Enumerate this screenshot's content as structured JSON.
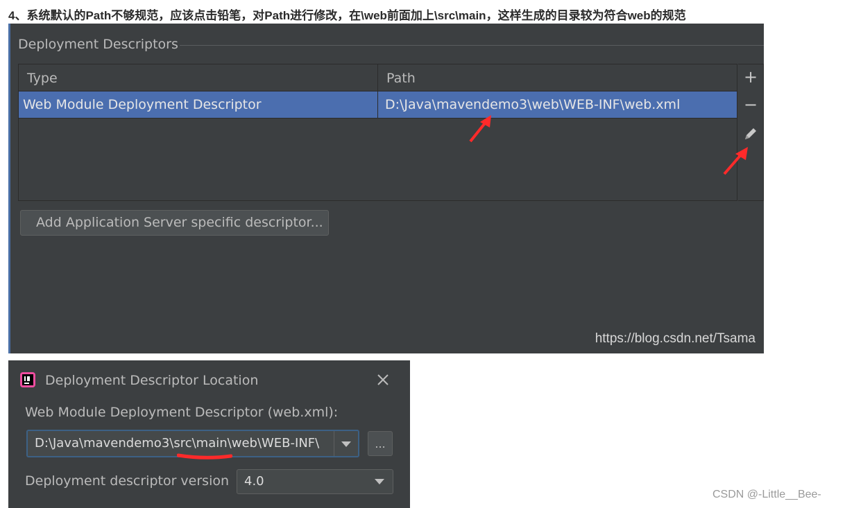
{
  "heading": "4、系统默认的Path不够规范，应该点击铅笔，对Path进行修改，在\\web前面加上\\src\\main，这样生成的目录较为符合web的规范",
  "panel": {
    "section_title": "Deployment Descriptors",
    "columns": {
      "type": "Type",
      "path": "Path"
    },
    "rows": [
      {
        "type": "Web Module Deployment Descriptor",
        "path": "D:\\Java\\mavendemo3\\web\\WEB-INF\\web.xml"
      }
    ],
    "tools": {
      "add": "+",
      "remove": "−",
      "edit_icon": "pencil-icon"
    },
    "add_button_label": "Add Application Server specific descriptor...",
    "watermark": "https://blog.csdn.net/Tsama"
  },
  "dialog": {
    "title": "Deployment Descriptor Location",
    "descriptor_label": "Web Module Deployment Descriptor (web.xml):",
    "path_value": "D:\\Java\\mavendemo3\\src\\main\\web\\WEB-INF\\",
    "browse_label": "...",
    "version_label": "Deployment descriptor version",
    "version_value": "4.0"
  },
  "watermark2": "CSDN @-Little__Bee-",
  "colors": {
    "panel_bg": "#3c3f41",
    "selection": "#4b6eaf",
    "annotation_red": "#ff2a2a"
  }
}
